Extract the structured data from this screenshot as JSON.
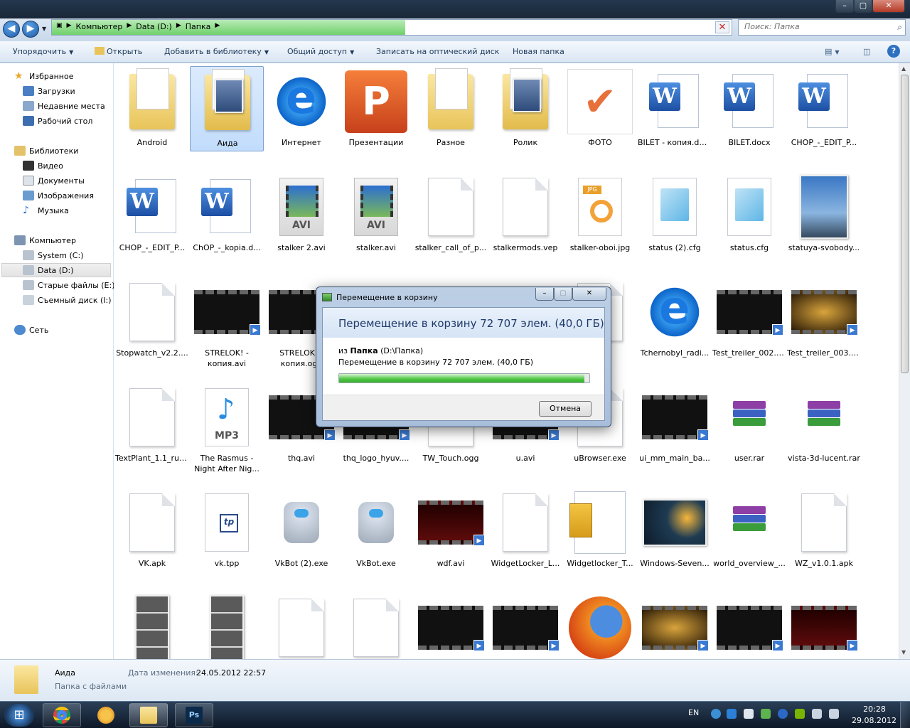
{
  "window": {
    "controls": {
      "minimize": "–",
      "maximize": "▢",
      "close": "✕"
    }
  },
  "address": {
    "back_icon": "◀",
    "forward_icon": "▶",
    "crumbs": [
      "Компьютер",
      "Data (D:)",
      "Папка"
    ],
    "progress_fraction": 0.52,
    "search_placeholder": "Поиск: Папка"
  },
  "toolbar": {
    "organize": "Упорядочить",
    "open": "Открыть",
    "add_to_library": "Добавить в библиотеку",
    "share": "Общий доступ",
    "burn": "Записать на оптический диск",
    "new_folder": "Новая папка"
  },
  "navpane": {
    "favorites": "Избранное",
    "downloads": "Загрузки",
    "recent": "Недавние места",
    "desktop": "Рабочий стол",
    "libraries": "Библиотеки",
    "video": "Видео",
    "documents": "Документы",
    "images": "Изображения",
    "music": "Музыка",
    "computer": "Компьютер",
    "system_c": "System (C:)",
    "data_d": "Data (D:)",
    "old_e": "Старые файлы (E:)",
    "removable_i": "Съемный диск (I:)",
    "network": "Сеть"
  },
  "files": [
    {
      "name": "Android",
      "kind": "folder"
    },
    {
      "name": "Аида",
      "kind": "folder-photo",
      "selected": true
    },
    {
      "name": "Интернет",
      "kind": "ie"
    },
    {
      "name": "Презентации",
      "kind": "ppt"
    },
    {
      "name": "Разное",
      "kind": "folder"
    },
    {
      "name": "Ролик",
      "kind": "folder-photo"
    },
    {
      "name": "ФОТО",
      "kind": "check"
    },
    {
      "name": "BILET - копия.docx",
      "kind": "word"
    },
    {
      "name": "BILET.docx",
      "kind": "word"
    },
    {
      "name": "CHOP_-_EDIT_P...",
      "kind": "word"
    },
    {
      "name": "CHOP_-_EDIT_P...",
      "kind": "word"
    },
    {
      "name": "ChOP_-_kopia.d...",
      "kind": "word"
    },
    {
      "name": "stalker 2.avi",
      "kind": "avi"
    },
    {
      "name": "stalker.avi",
      "kind": "avi"
    },
    {
      "name": "stalker_call_of_p...",
      "kind": "doc"
    },
    {
      "name": "stalkermods.vep",
      "kind": "doc"
    },
    {
      "name": "stalker-oboi.jpg",
      "kind": "jpg"
    },
    {
      "name": "status (2).cfg",
      "kind": "cfg"
    },
    {
      "name": "status.cfg",
      "kind": "cfg"
    },
    {
      "name": "statuya-svobody...",
      "kind": "photo"
    },
    {
      "name": "Stopwatch_v2.2....",
      "kind": "doc"
    },
    {
      "name": "STRELOK! - копия.avi",
      "kind": "film"
    },
    {
      "name": "STRELOK! - копия.ogg",
      "kind": "film"
    },
    {
      "name": "",
      "kind": "hidden"
    },
    {
      "name": "",
      "kind": "hidden"
    },
    {
      "name": "",
      "kind": "hidden"
    },
    {
      "name": "",
      "kind": "doc"
    },
    {
      "name": "Tchernobyl_radi...",
      "kind": "ie"
    },
    {
      "name": "Test_treiler_002.avi",
      "kind": "film"
    },
    {
      "name": "Test_treiler_003.avi",
      "kind": "film-gold"
    },
    {
      "name": "TextPlant_1.1_rus...",
      "kind": "doc"
    },
    {
      "name": "The Rasmus - Night After Nig...",
      "kind": "mp3"
    },
    {
      "name": "thq.avi",
      "kind": "film"
    },
    {
      "name": "thq_logo_hyuv....",
      "kind": "film"
    },
    {
      "name": "TW_Touch.ogg",
      "kind": "doc"
    },
    {
      "name": "u.avi",
      "kind": "film"
    },
    {
      "name": "uBrowser.exe",
      "kind": "doc"
    },
    {
      "name": "ui_mm_main_ba...",
      "kind": "film"
    },
    {
      "name": "user.rar",
      "kind": "rar"
    },
    {
      "name": "vista-3d-lucent.rar",
      "kind": "rar"
    },
    {
      "name": "VK.apk",
      "kind": "doc"
    },
    {
      "name": "vk.tpp",
      "kind": "tpp"
    },
    {
      "name": "VkBot (2).exe",
      "kind": "robot"
    },
    {
      "name": "VkBot.exe",
      "kind": "robot"
    },
    {
      "name": "wdf.avi",
      "kind": "film-red"
    },
    {
      "name": "WidgetLocker_L...",
      "kind": "doc"
    },
    {
      "name": "Widgetlocker_T...",
      "kind": "zip"
    },
    {
      "name": "Windows-Seven...",
      "kind": "photo-dark"
    },
    {
      "name": "world_overview_...",
      "kind": "rar"
    },
    {
      "name": "WZ_v1.0.1.apk",
      "kind": "doc"
    },
    {
      "name": "",
      "kind": "photo-strip"
    },
    {
      "name": "",
      "kind": "photo-strip"
    },
    {
      "name": "",
      "kind": "doc"
    },
    {
      "name": "",
      "kind": "doc"
    },
    {
      "name": "",
      "kind": "film"
    },
    {
      "name": "",
      "kind": "film"
    },
    {
      "name": "",
      "kind": "firefox"
    },
    {
      "name": "",
      "kind": "film-gold"
    },
    {
      "name": "",
      "kind": "film"
    },
    {
      "name": "",
      "kind": "film-red"
    }
  ],
  "details": {
    "name": "Аида",
    "type": "Папка с файлами",
    "date_label": "Дата изменения:",
    "date_value": "24.05.2012 22:57"
  },
  "dialog": {
    "title": "Перемещение в корзину",
    "heading": "Перемещение в корзину 72 707 элем. (40,0 ГБ)",
    "from_prefix": "из",
    "from_name": "Папка",
    "from_path": "(D:\\Папка)",
    "status": "Перемещение в корзину 72 707 элем. (40,0 ГБ)",
    "progress_fraction": 0.98,
    "cancel": "Отмена",
    "min": "–",
    "max": "▢",
    "close": "✕"
  },
  "taskbar": {
    "lang": "EN",
    "time": "20:28",
    "date": "29.08.2012",
    "start_icon": "windows-orb"
  }
}
